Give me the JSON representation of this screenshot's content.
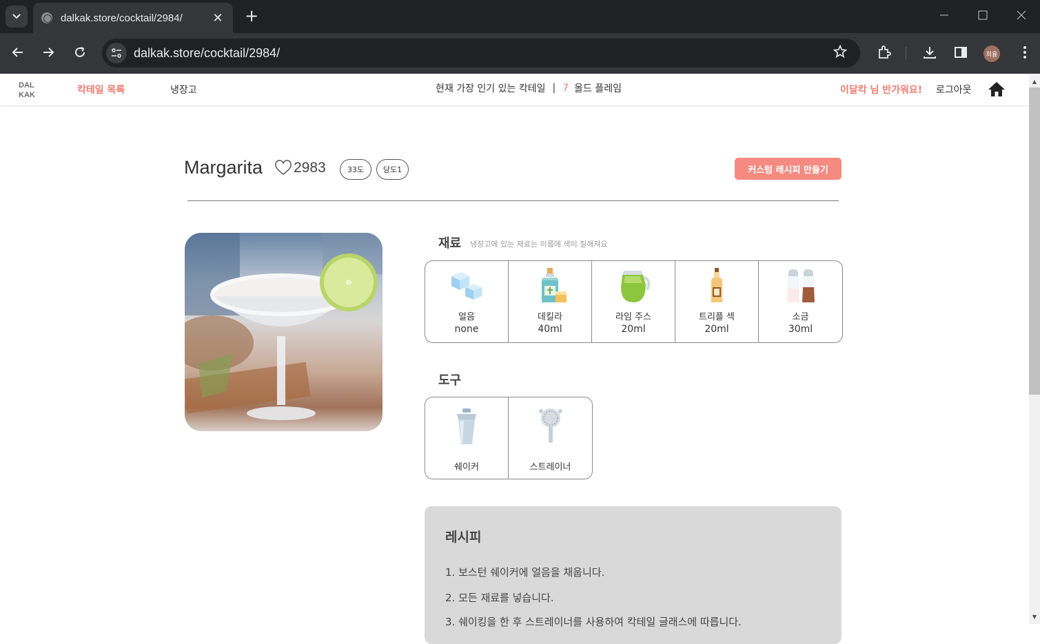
{
  "browser": {
    "tab_title": "dalkak.store/cocktail/2984/",
    "tab_close": "✕",
    "new_tab": "+",
    "url": "dalkak.store/cocktail/2984/",
    "profile_initials": "희융"
  },
  "header": {
    "logo_line1": "DAL",
    "logo_line2": "KAK",
    "nav_cocktails": "칵테일 목록",
    "nav_fridge": "냉장고",
    "popular_label": "현재 가장 인기 있는 칵테일",
    "popular_sep": "|",
    "popular_rank": "7",
    "popular_name": "올드 플레임",
    "greeting": "이달칵 님 반가워요!",
    "logout": "로그아웃"
  },
  "cocktail": {
    "name": "Margarita",
    "likes": "2983",
    "abv_badge": "33도",
    "sugar_badge": "당도1",
    "custom_button": "커스텀 레시피 만들기"
  },
  "ingredients": {
    "title": "재료",
    "hint": "냉장고에 있는 재료는 이름에 색이 칠해져요",
    "items": [
      {
        "name": "얼음",
        "amount": "none",
        "icon": "ice-icon"
      },
      {
        "name": "데킬라",
        "amount": "40ml",
        "icon": "tequila-icon"
      },
      {
        "name": "라임 주스",
        "amount": "20ml",
        "icon": "lime-juice-icon"
      },
      {
        "name": "트리플 섹",
        "amount": "20ml",
        "icon": "triple-sec-icon"
      },
      {
        "name": "소금",
        "amount": "30ml",
        "icon": "salt-icon"
      }
    ]
  },
  "tools": {
    "title": "도구",
    "items": [
      {
        "name": "쉐이커",
        "icon": "shaker-icon"
      },
      {
        "name": "스트레이너",
        "icon": "strainer-icon"
      }
    ]
  },
  "recipe": {
    "title": "레시피",
    "steps": [
      "1. 보스턴 쉐이커에 얼음을 채웁니다.",
      "2. 모든 재료를 넣습니다.",
      "3. 쉐이킹을 한 후 스트레이너를 사용하여 칵테일 글래스에 따릅니다."
    ]
  },
  "colors": {
    "accent": "#f07c6f",
    "button": "#f48a80",
    "recipe_bg": "#d9d9d9"
  }
}
